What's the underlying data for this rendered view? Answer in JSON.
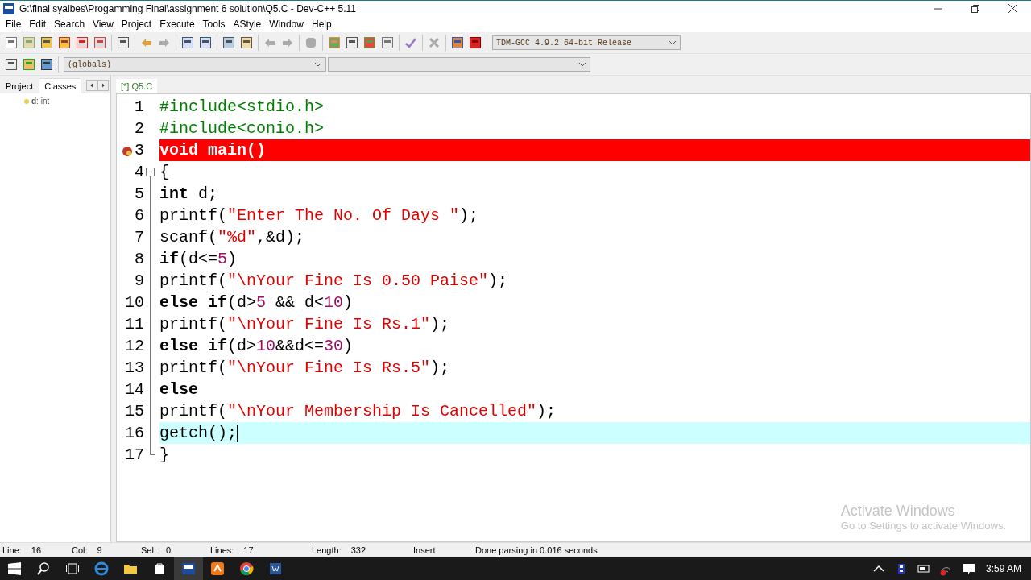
{
  "window": {
    "title": "G:\\final syalbes\\Progamming Final\\assignment 6 solution\\Q5.C - Dev-C++ 5.11"
  },
  "menu": [
    "File",
    "Edit",
    "Search",
    "View",
    "Project",
    "Execute",
    "Tools",
    "AStyle",
    "Window",
    "Help"
  ],
  "compiler_select": {
    "value": "TDM-GCC 4.9.2 64-bit Release"
  },
  "scope_select": {
    "value": "(globals)"
  },
  "side_tabs": [
    {
      "label": "Project",
      "selected": false
    },
    {
      "label": "Classes",
      "selected": true
    }
  ],
  "class_tree": [
    {
      "text": "**d**: int"
    }
  ],
  "editor_tabs": [
    {
      "label": "[*] Q5.C",
      "selected": true
    }
  ],
  "code_lines": [
    {
      "number": "1",
      "tokens": [
        {
          "kind": "pp",
          "text": "#include<stdio.h>"
        }
      ]
    },
    {
      "number": "2",
      "tokens": [
        {
          "kind": "pp",
          "text": "#include<conio.h>"
        }
      ]
    },
    {
      "number": "3",
      "breakpoint": true,
      "tokens": [
        {
          "kind": "kw",
          "text": "void"
        },
        {
          "kind": "plain",
          "text": " main()"
        }
      ]
    },
    {
      "number": "4",
      "fold_start": true,
      "tokens": [
        {
          "kind": "plain",
          "text": "{"
        }
      ]
    },
    {
      "number": "5",
      "tokens": [
        {
          "kind": "kw",
          "text": "int"
        },
        {
          "kind": "plain",
          "text": " d;"
        }
      ]
    },
    {
      "number": "6",
      "tokens": [
        {
          "kind": "plain",
          "text": "printf("
        },
        {
          "kind": "str",
          "text": "\"Enter The No. Of Days \""
        },
        {
          "kind": "plain",
          "text": ");"
        }
      ]
    },
    {
      "number": "7",
      "tokens": [
        {
          "kind": "plain",
          "text": "scanf("
        },
        {
          "kind": "str",
          "text": "\"%d\""
        },
        {
          "kind": "plain",
          "text": ",&d);"
        }
      ]
    },
    {
      "number": "8",
      "tokens": [
        {
          "kind": "kw",
          "text": "if"
        },
        {
          "kind": "plain",
          "text": "(d<="
        },
        {
          "kind": "num",
          "text": "5"
        },
        {
          "kind": "plain",
          "text": ")"
        }
      ]
    },
    {
      "number": "9",
      "tokens": [
        {
          "kind": "plain",
          "text": "printf("
        },
        {
          "kind": "str",
          "text": "\"\\nYour Fine Is 0.50 Paise\""
        },
        {
          "kind": "plain",
          "text": ");"
        }
      ]
    },
    {
      "number": "10",
      "tokens": [
        {
          "kind": "kw",
          "text": "else"
        },
        {
          "kind": "kw",
          "text": " if"
        },
        {
          "kind": "plain",
          "text": "(d>"
        },
        {
          "kind": "num",
          "text": "5"
        },
        {
          "kind": "plain",
          "text": " && d<"
        },
        {
          "kind": "num",
          "text": "10"
        },
        {
          "kind": "plain",
          "text": ")"
        }
      ]
    },
    {
      "number": "11",
      "tokens": [
        {
          "kind": "plain",
          "text": "printf("
        },
        {
          "kind": "str",
          "text": "\"\\nYour Fine Is Rs.1\""
        },
        {
          "kind": "plain",
          "text": ");"
        }
      ]
    },
    {
      "number": "12",
      "tokens": [
        {
          "kind": "kw",
          "text": "else"
        },
        {
          "kind": "kw",
          "text": " if"
        },
        {
          "kind": "plain",
          "text": "(d>"
        },
        {
          "kind": "num",
          "text": "10"
        },
        {
          "kind": "plain",
          "text": "&&d<="
        },
        {
          "kind": "num",
          "text": "30"
        },
        {
          "kind": "plain",
          "text": ")"
        }
      ]
    },
    {
      "number": "13",
      "tokens": [
        {
          "kind": "plain",
          "text": "printf("
        },
        {
          "kind": "str",
          "text": "\"\\nYour Fine Is Rs.5\""
        },
        {
          "kind": "plain",
          "text": ");"
        }
      ]
    },
    {
      "number": "14",
      "tokens": [
        {
          "kind": "kw",
          "text": "else"
        }
      ]
    },
    {
      "number": "15",
      "tokens": [
        {
          "kind": "plain",
          "text": "printf("
        },
        {
          "kind": "str",
          "text": "\"\\nYour Membership Is Cancelled\""
        },
        {
          "kind": "plain",
          "text": ");"
        }
      ]
    },
    {
      "number": "16",
      "current_line": true,
      "caret": true,
      "tokens": [
        {
          "kind": "plain",
          "text": "getch();"
        }
      ]
    },
    {
      "number": "17",
      "fold_end": true,
      "tokens": [
        {
          "kind": "plain",
          "text": "}"
        }
      ]
    }
  ],
  "activation_notice": {
    "title": "Activate Windows",
    "text": "Go to Settings to activate Windows."
  },
  "status_bar": [
    {
      "label": "Line:",
      "value": "16"
    },
    {
      "label": "Col:",
      "value": "9"
    },
    {
      "label": "Sel:",
      "value": "0"
    },
    {
      "label": "Lines:",
      "value": "17"
    },
    {
      "label": "Length:",
      "value": "332"
    },
    {
      "value": "Insert"
    },
    {
      "value": "Done parsing in 0.016 seconds"
    }
  ],
  "taskbar": {
    "clock": "3:59 AM"
  }
}
